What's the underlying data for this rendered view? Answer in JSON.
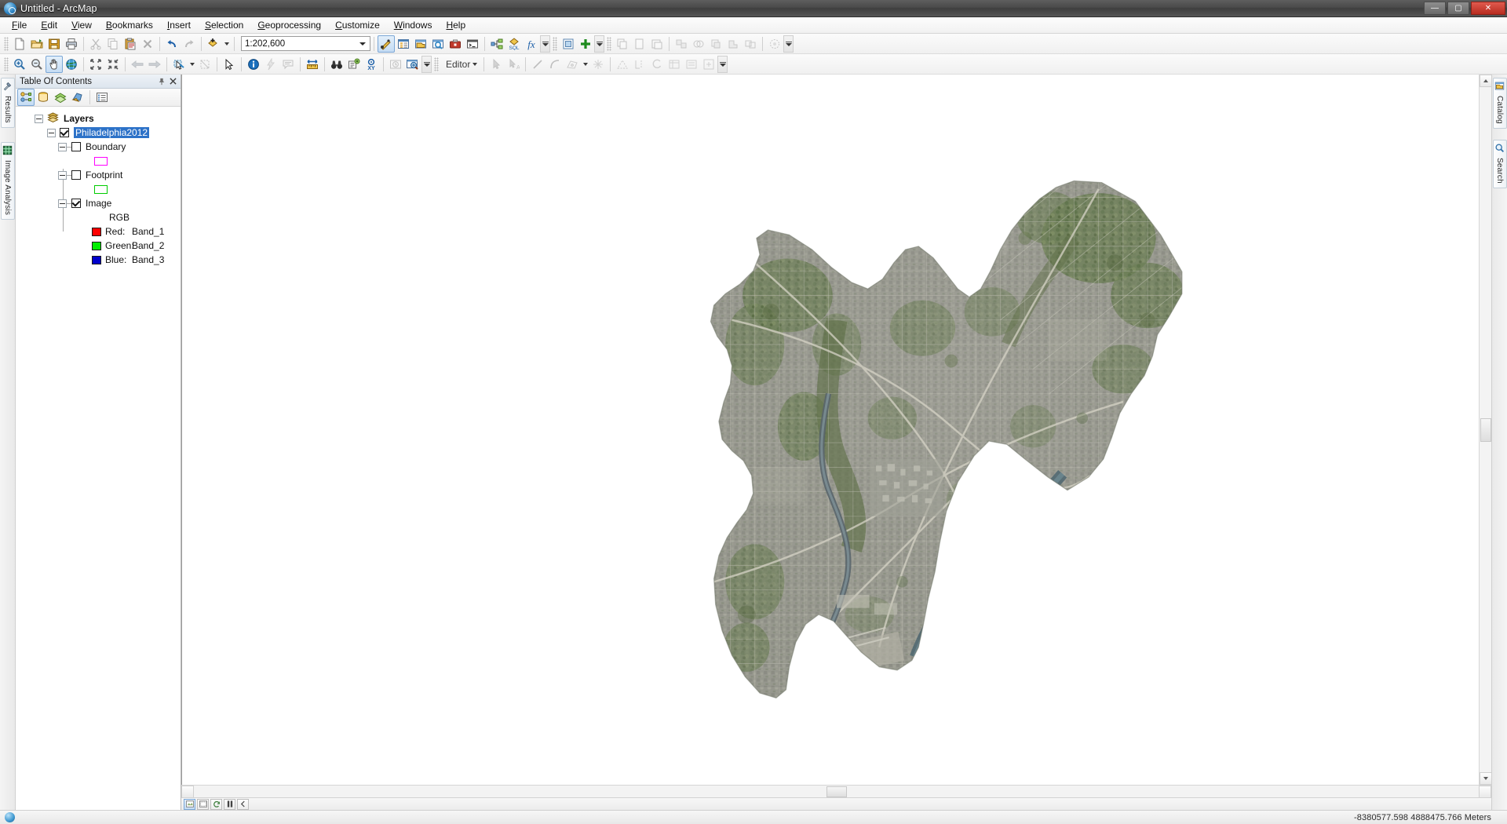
{
  "window": {
    "title": "Untitled - ArcMap",
    "app_icon": "globe-magnifier-icon",
    "buttons": {
      "minimize": "—",
      "maximize": "▢",
      "close": "✕"
    }
  },
  "menubar": {
    "items": [
      {
        "label": "File",
        "mnemonic": "F"
      },
      {
        "label": "Edit",
        "mnemonic": "E"
      },
      {
        "label": "View",
        "mnemonic": "V"
      },
      {
        "label": "Bookmarks",
        "mnemonic": "B"
      },
      {
        "label": "Insert",
        "mnemonic": "I"
      },
      {
        "label": "Selection",
        "mnemonic": "S"
      },
      {
        "label": "Geoprocessing",
        "mnemonic": "G"
      },
      {
        "label": "Customize",
        "mnemonic": "C"
      },
      {
        "label": "Windows",
        "mnemonic": "W"
      },
      {
        "label": "Help",
        "mnemonic": "H"
      }
    ]
  },
  "standard_toolbar": {
    "buttons": [
      "new-document-icon",
      "open-folder-icon",
      "save-icon",
      "print-icon",
      "cut-scissors-icon",
      "copy-icon",
      "paste-icon",
      "delete-x-icon",
      "undo-arrow-icon",
      "redo-arrow-icon",
      "add-data-icon"
    ],
    "scale": {
      "value": "1:202,600",
      "name": "map-scale-combo"
    },
    "right_buttons": [
      "editor-toolbar-icon",
      "table-of-contents-icon",
      "catalog-icon",
      "search-icon",
      "arctoolbox-icon",
      "python-window-icon",
      "model-builder-icon",
      "sql-icon",
      "image-analysis-icon",
      "effects-icon",
      "add-plus-icon"
    ]
  },
  "tools_toolbar": {
    "buttons": [
      "zoom-in-icon",
      "zoom-out-icon",
      "pan-hand-icon",
      "full-extent-globe-icon",
      "fixed-zoom-in-icon",
      "fixed-zoom-out-icon",
      "go-back-extent-icon",
      "go-forward-extent-icon",
      "select-features-icon",
      "clear-selection-icon",
      "select-elements-arrow-icon",
      "identify-info-icon",
      "hyperlink-icon",
      "html-popup-icon",
      "measure-icon",
      "find-binoculars-icon",
      "find-route-icon",
      "go-to-xy-icon",
      "time-slider-icon",
      "create-viewer-window-icon"
    ],
    "active_tool": "pan-hand-icon"
  },
  "editor_toolbar": {
    "menu_label": "Editor",
    "buttons": [
      "edit-tool-arrow-icon",
      "edit-annotation-icon",
      "straight-segment-icon",
      "arc-segment-icon",
      "edit-vertices-icon",
      "trace-icon",
      "construction-icon",
      "split-icon",
      "rotate-icon",
      "attributes-icon",
      "sketch-properties-icon",
      "create-features-icon"
    ]
  },
  "left_dock": {
    "tabs": [
      {
        "label": "Results",
        "icon": "results-hammer-icon"
      },
      {
        "label": "Image Analysis",
        "icon": "image-analysis-grid-icon"
      }
    ]
  },
  "right_dock": {
    "tabs": [
      {
        "label": "Catalog",
        "icon": "catalog-icon"
      },
      {
        "label": "Search",
        "icon": "search-icon"
      }
    ]
  },
  "toc": {
    "title": "Table Of Contents",
    "pin_icon": "pin-icon",
    "close_icon": "close-icon",
    "view_buttons": [
      {
        "name": "list-by-drawing-order",
        "icon": "drawing-order-icon",
        "active": true
      },
      {
        "name": "list-by-source",
        "icon": "source-icon",
        "active": false
      },
      {
        "name": "list-by-visibility",
        "icon": "visibility-icon",
        "active": false
      },
      {
        "name": "list-by-selection",
        "icon": "selection-icon",
        "active": false
      },
      {
        "name": "options",
        "icon": "options-list-icon",
        "active": false
      }
    ],
    "tree": {
      "root": {
        "label": "Layers",
        "icon": "layers-stack-icon",
        "expanded": true
      },
      "layer": {
        "label": "Philadelphia2012",
        "checked": true,
        "selected": true,
        "expanded": true
      },
      "children": [
        {
          "label": "Boundary",
          "checked": false,
          "expanded": true,
          "symbol": {
            "type": "outline-rect",
            "color": "#ff00ff"
          }
        },
        {
          "label": "Footprint",
          "checked": false,
          "expanded": true,
          "symbol": {
            "type": "outline-rect",
            "color": "#00cc00"
          }
        },
        {
          "label": "Image",
          "checked": true,
          "expanded": true,
          "renderer": "RGB",
          "bands": [
            {
              "channel": "Red:",
              "band": "Band_1",
              "color": "#ff0000"
            },
            {
              "channel": "Green:",
              "band": "Band_2",
              "color": "#00ee00"
            },
            {
              "channel": "Blue:",
              "band": "Band_3",
              "color": "#0000cc"
            }
          ]
        }
      ]
    }
  },
  "map_view": {
    "data_frame": "Layers",
    "footer_buttons": [
      {
        "name": "data-view-button",
        "icon": "data-view-icon",
        "active": true
      },
      {
        "name": "layout-view-button",
        "icon": "layout-view-icon",
        "active": false
      },
      {
        "name": "refresh-view-button",
        "icon": "refresh-icon",
        "active": false
      },
      {
        "name": "pause-drawing-button",
        "icon": "pause-icon",
        "active": false
      },
      {
        "name": "previous-extent-button",
        "icon": "left-arrow-icon",
        "active": false
      }
    ],
    "imagery_alt": "Philadelphia 2012 aerial orthophoto mosaic"
  },
  "statusbar": {
    "coordinates": "-8380577.598  4888475.766 Meters",
    "units": "Meters"
  },
  "colors": {
    "accent": "#2d72c8",
    "titlebar": "#4a4a4a",
    "boundary": "#ff00ff",
    "footprint": "#00cc00",
    "red_band": "#ff0000",
    "green_band": "#00ee00",
    "blue_band": "#0000cc"
  }
}
